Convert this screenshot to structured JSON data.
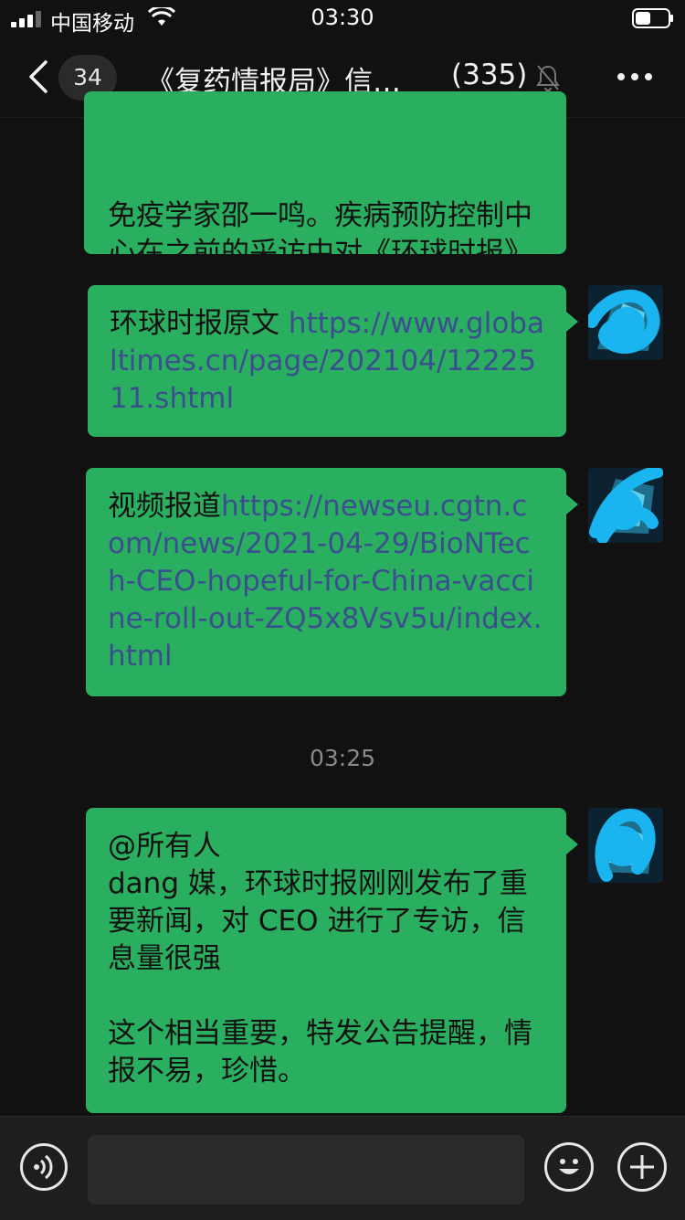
{
  "status_bar": {
    "carrier": "中国移动",
    "time": "03:30",
    "icons": [
      "signal-icon",
      "wifi-icon",
      "battery-icon"
    ]
  },
  "nav": {
    "back_icon": "chevron-left-icon",
    "unread_count": "34",
    "title": "《复药情报局》信…",
    "member_count": "(335)",
    "mute_icon": "bell-muted-icon",
    "more_icon": "ellipsis-icon"
  },
  "messages": [
    {
      "text": "免疫学家邵一鸣。疾病预防控制中心在之前的采访中对《环球时报》表示。"
    },
    {
      "prefix": "环球时报原文 ",
      "link": "https://www.globaltimes.cn/page/202104/1222511.shtml"
    },
    {
      "prefix": "视频报道",
      "link": "https://newseu.cgtn.com/news/2021-04-29/BioNTech-CEO-hopeful-for-China-vaccine-roll-out-ZQ5x8Vsv5u/index.html"
    },
    {
      "text": "@所有人\ndang 媒，环球时报刚刚发布了重要新闻，对 CEO 进行了专访，信息量很强\n\n这个相当重要，特发公告提醒，情报不易，珍惜。"
    }
  ],
  "timestamp": "03:25",
  "input_bar": {
    "voice_icon": "voice-icon",
    "input_value": "",
    "emoji_icon": "emoji-icon",
    "plus_icon": "plus-icon"
  },
  "colors": {
    "background": "#111111",
    "bubble": "#2aae5f",
    "link": "#3b4f8f",
    "timestamp": "#8a8a8a",
    "input_bar": "#1e1e1e"
  }
}
